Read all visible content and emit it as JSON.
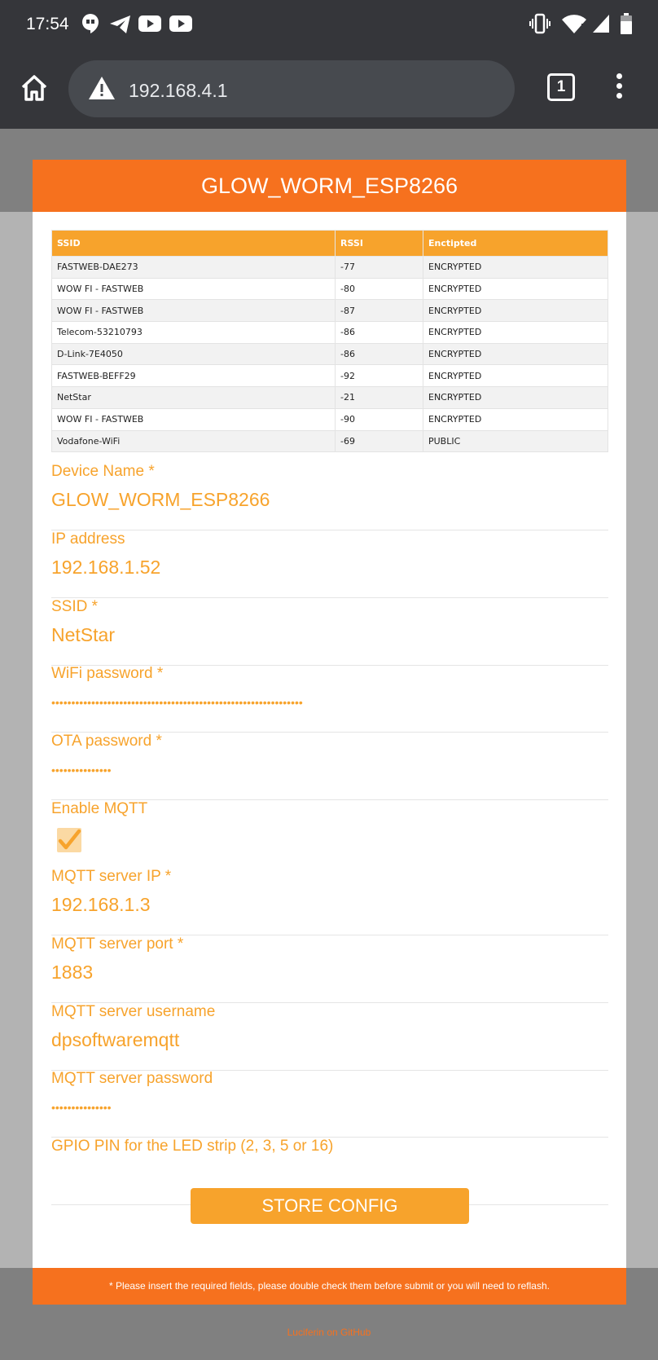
{
  "statusbar": {
    "time": "17:54",
    "left_icons": [
      "hangouts-icon",
      "telegram-icon",
      "youtube-icon",
      "youtube-icon"
    ],
    "right_icons": [
      "vibrate-icon",
      "wifi-icon",
      "signal-icon",
      "battery-icon"
    ]
  },
  "browser": {
    "url": "192.168.4.1",
    "tab_count": "1"
  },
  "page": {
    "title": "GLOW_WORM_ESP8266",
    "table": {
      "headers": [
        "SSID",
        "RSSI",
        "Enctipted"
      ],
      "rows": [
        [
          "FASTWEB-DAE273",
          "-77",
          "ENCRYPTED"
        ],
        [
          "WOW FI - FASTWEB",
          "-80",
          "ENCRYPTED"
        ],
        [
          "WOW FI - FASTWEB",
          "-87",
          "ENCRYPTED"
        ],
        [
          "Telecom-53210793",
          "-86",
          "ENCRYPTED"
        ],
        [
          "D-Link-7E4050",
          "-86",
          "ENCRYPTED"
        ],
        [
          "FASTWEB-BEFF29",
          "-92",
          "ENCRYPTED"
        ],
        [
          "NetStar",
          "-21",
          "ENCRYPTED"
        ],
        [
          "WOW FI - FASTWEB",
          "-90",
          "ENCRYPTED"
        ],
        [
          "Vodafone-WiFi",
          "-69",
          "PUBLIC"
        ]
      ]
    },
    "fields": {
      "device_name": {
        "label": "Device Name *",
        "value": "GLOW_WORM_ESP8266"
      },
      "ip": {
        "label": "IP address",
        "value": "192.168.1.52"
      },
      "ssid": {
        "label": "SSID *",
        "value": "NetStar"
      },
      "wifi_password": {
        "label": "WiFi password *",
        "value": "•••••••••••••••••••••••••••••••••••••••••••••••••••••••••••••••"
      },
      "ota_password": {
        "label": "OTA password *",
        "value": "•••••••••••••••"
      },
      "enable_mqtt": {
        "label": "Enable MQTT",
        "checked": true
      },
      "mqtt_ip": {
        "label": "MQTT server IP *",
        "value": "192.168.1.3"
      },
      "mqtt_port": {
        "label": "MQTT server port *",
        "value": "1883"
      },
      "mqtt_user": {
        "label": "MQTT server username",
        "value": "dpsoftwaremqtt"
      },
      "mqtt_password": {
        "label": "MQTT server password",
        "value": "•••••••••••••••"
      },
      "gpio": {
        "label": "GPIO PIN for the LED strip (2, 3, 5 or 16)",
        "value": ""
      }
    },
    "store_button": "STORE CONFIG",
    "footer_note": "* Please insert the required fields, please double check them before submit or you will need to reflash.",
    "github_link": "Luciferin on GitHub"
  },
  "colors": {
    "header": "#f6711e",
    "accent": "#f7a32c",
    "status_bar": "#35363a"
  }
}
